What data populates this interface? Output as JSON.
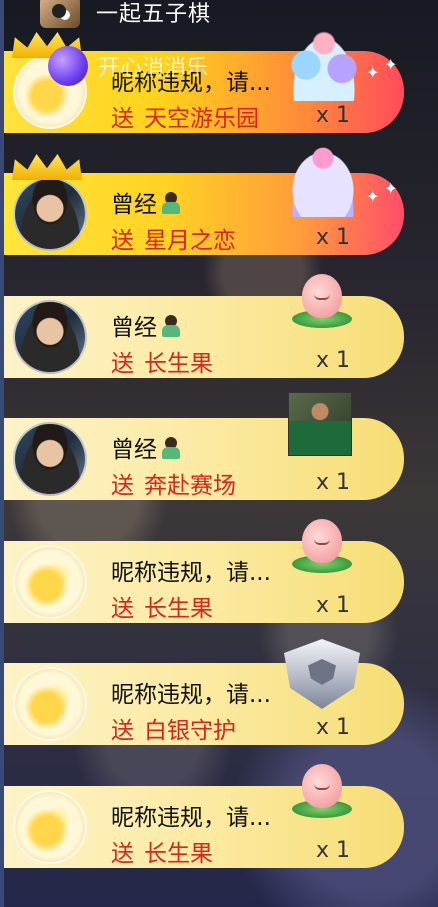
{
  "top_game": {
    "label": "一起五子棋",
    "icon": "gomoku-icon"
  },
  "overlay_game": {
    "label": "开心消消乐",
    "icon": "purple-ball-icon"
  },
  "feed": [
    {
      "user": "昵称违规，请...",
      "send": "送",
      "gift": "天空游乐园",
      "count": "x 1",
      "gift_icon": "sky-amusement-park-icon",
      "style": "gold-red",
      "crown": true
    },
    {
      "user": "曾经",
      "send": "送",
      "gift": "星月之恋",
      "count": "x 1",
      "gift_icon": "star-moon-love-carousel-icon",
      "style": "gold-pink",
      "crown": true
    },
    {
      "user": "曾经",
      "send": "送",
      "gift": "长生果",
      "count": "x 1",
      "gift_icon": "peach-icon",
      "style": "yellow",
      "crown": false
    },
    {
      "user": "曾经",
      "send": "送",
      "gift": "奔赴赛场",
      "count": "x 1",
      "gift_icon": "soccer-player-icon",
      "style": "yellow",
      "crown": false
    },
    {
      "user": "昵称违规，请...",
      "send": "送",
      "gift": "长生果",
      "count": "x 1",
      "gift_icon": "peach-icon",
      "style": "yellow",
      "crown": false
    },
    {
      "user": "昵称违规，请...",
      "send": "送",
      "gift": "白银守护",
      "count": "x 1",
      "gift_icon": "silver-shield-icon",
      "style": "yellow",
      "crown": false
    },
    {
      "user": "昵称违规，请...",
      "send": "送",
      "gift": "长生果",
      "count": "x 1",
      "gift_icon": "peach-icon",
      "style": "yellow",
      "crown": false
    }
  ]
}
